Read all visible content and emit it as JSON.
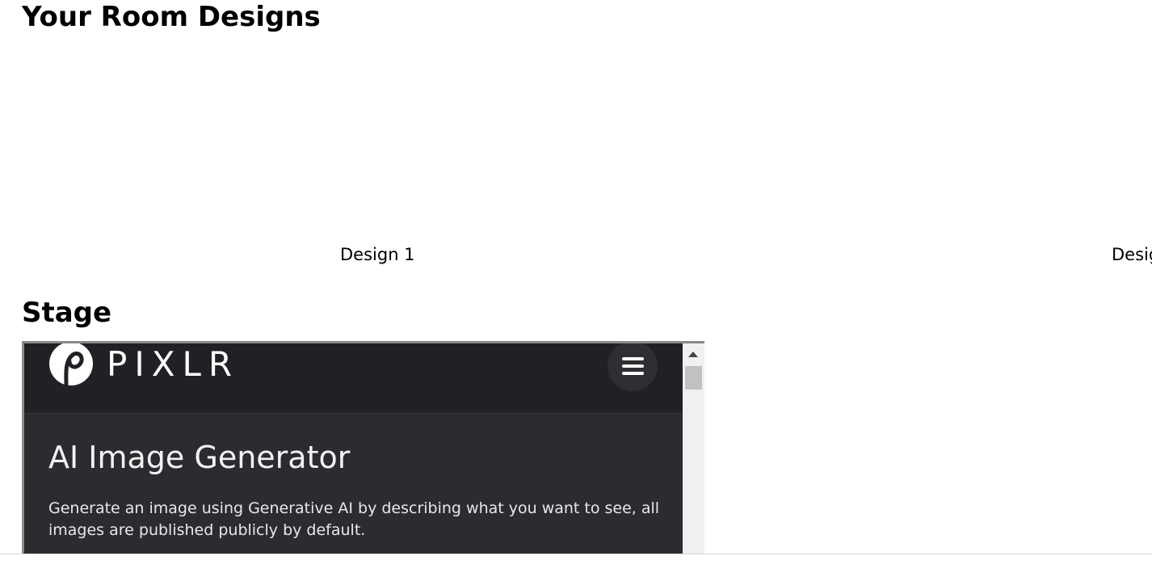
{
  "page": {
    "designs_heading": "Your Room Designs",
    "designs": [
      {
        "label": "Design 1"
      },
      {
        "label": "Desig"
      }
    ],
    "stage_heading": "Stage"
  },
  "embed": {
    "brand": "PIXLR",
    "title": "AI Image Generator",
    "description": "Generate an image using Generative AI by describing what you want to see, all images are published publicly by default.",
    "icons": {
      "logo": "pixlr-logo-icon",
      "menu": "hamburger-menu-icon",
      "scroll_up": "scroll-up-arrow-icon"
    },
    "colors": {
      "header_bg": "#1f2124",
      "body_bg": "#2a2c30",
      "text": "#ffffff"
    }
  }
}
